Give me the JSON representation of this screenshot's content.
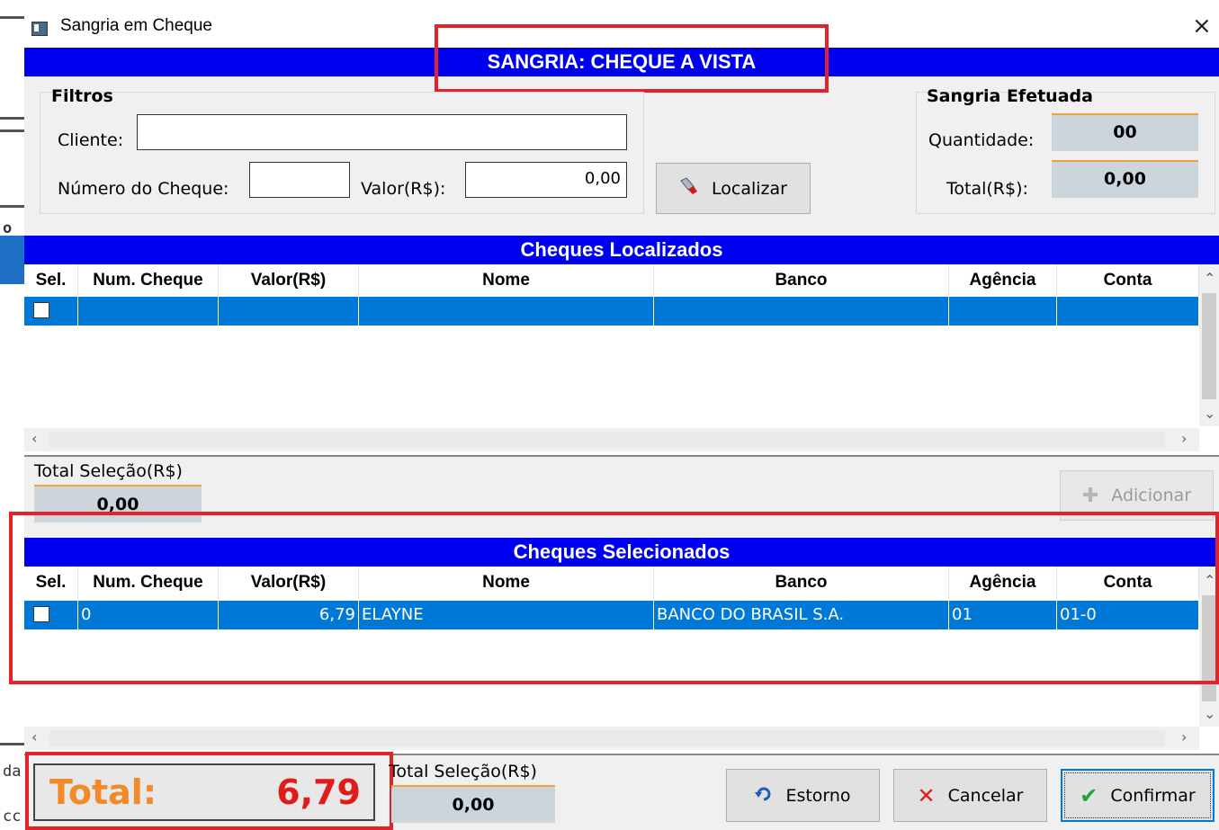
{
  "window": {
    "title": "Sangria em Cheque",
    "close_glyph": "×"
  },
  "header": {
    "title": "SANGRIA: CHEQUE A VISTA"
  },
  "filters": {
    "group_label": "Filtros",
    "cliente_label": "Cliente:",
    "cliente_value": "",
    "numero_label": "Número do Cheque:",
    "numero_value": "",
    "valor_label": "Valor(R$):",
    "valor_value": "0,00",
    "localizar_label": "Localizar"
  },
  "sangria_efetuada": {
    "group_label": "Sangria Efetuada",
    "quantidade_label": "Quantidade:",
    "quantidade_value": "00",
    "total_label": "Total(R$):",
    "total_value": "0,00"
  },
  "localizados": {
    "title": "Cheques Localizados",
    "columns": [
      "Sel.",
      "Num. Cheque",
      "Valor(R$)",
      "Nome",
      "Banco",
      "Agência",
      "Conta"
    ],
    "rows": [
      {
        "checked": false,
        "cells": [
          "",
          "",
          "",
          "",
          "",
          ""
        ]
      }
    ],
    "total_selecao_label": "Total Seleção(R$)",
    "total_selecao_value": "0,00",
    "adicionar_label": "Adicionar"
  },
  "selecionados": {
    "title": "Cheques Selecionados",
    "columns": [
      "Sel.",
      "Num. Cheque",
      "Valor(R$)",
      "Nome",
      "Banco",
      "Agência",
      "Conta"
    ],
    "rows": [
      {
        "checked": false,
        "cells": [
          "0",
          "6,79",
          "ELAYNE",
          "BANCO DO BRASIL S.A.",
          "01",
          "01-0"
        ]
      }
    ],
    "total_selecao_label": "Total Seleção(R$)",
    "total_selecao_value": "0,00"
  },
  "footer": {
    "total_label": "Total:",
    "total_value": "6,79",
    "estorno_label": "Estorno",
    "cancelar_label": "Cancelar",
    "confirmar_label": "Confirmar"
  },
  "background_fragments": [
    "o",
    "da",
    "cc"
  ],
  "colors": {
    "header_blue": "#0000f0",
    "row_selected": "#0078d7",
    "highlight_red": "#e3222a",
    "total_orange": "#f28a2a",
    "total_red": "#e01b1b"
  }
}
